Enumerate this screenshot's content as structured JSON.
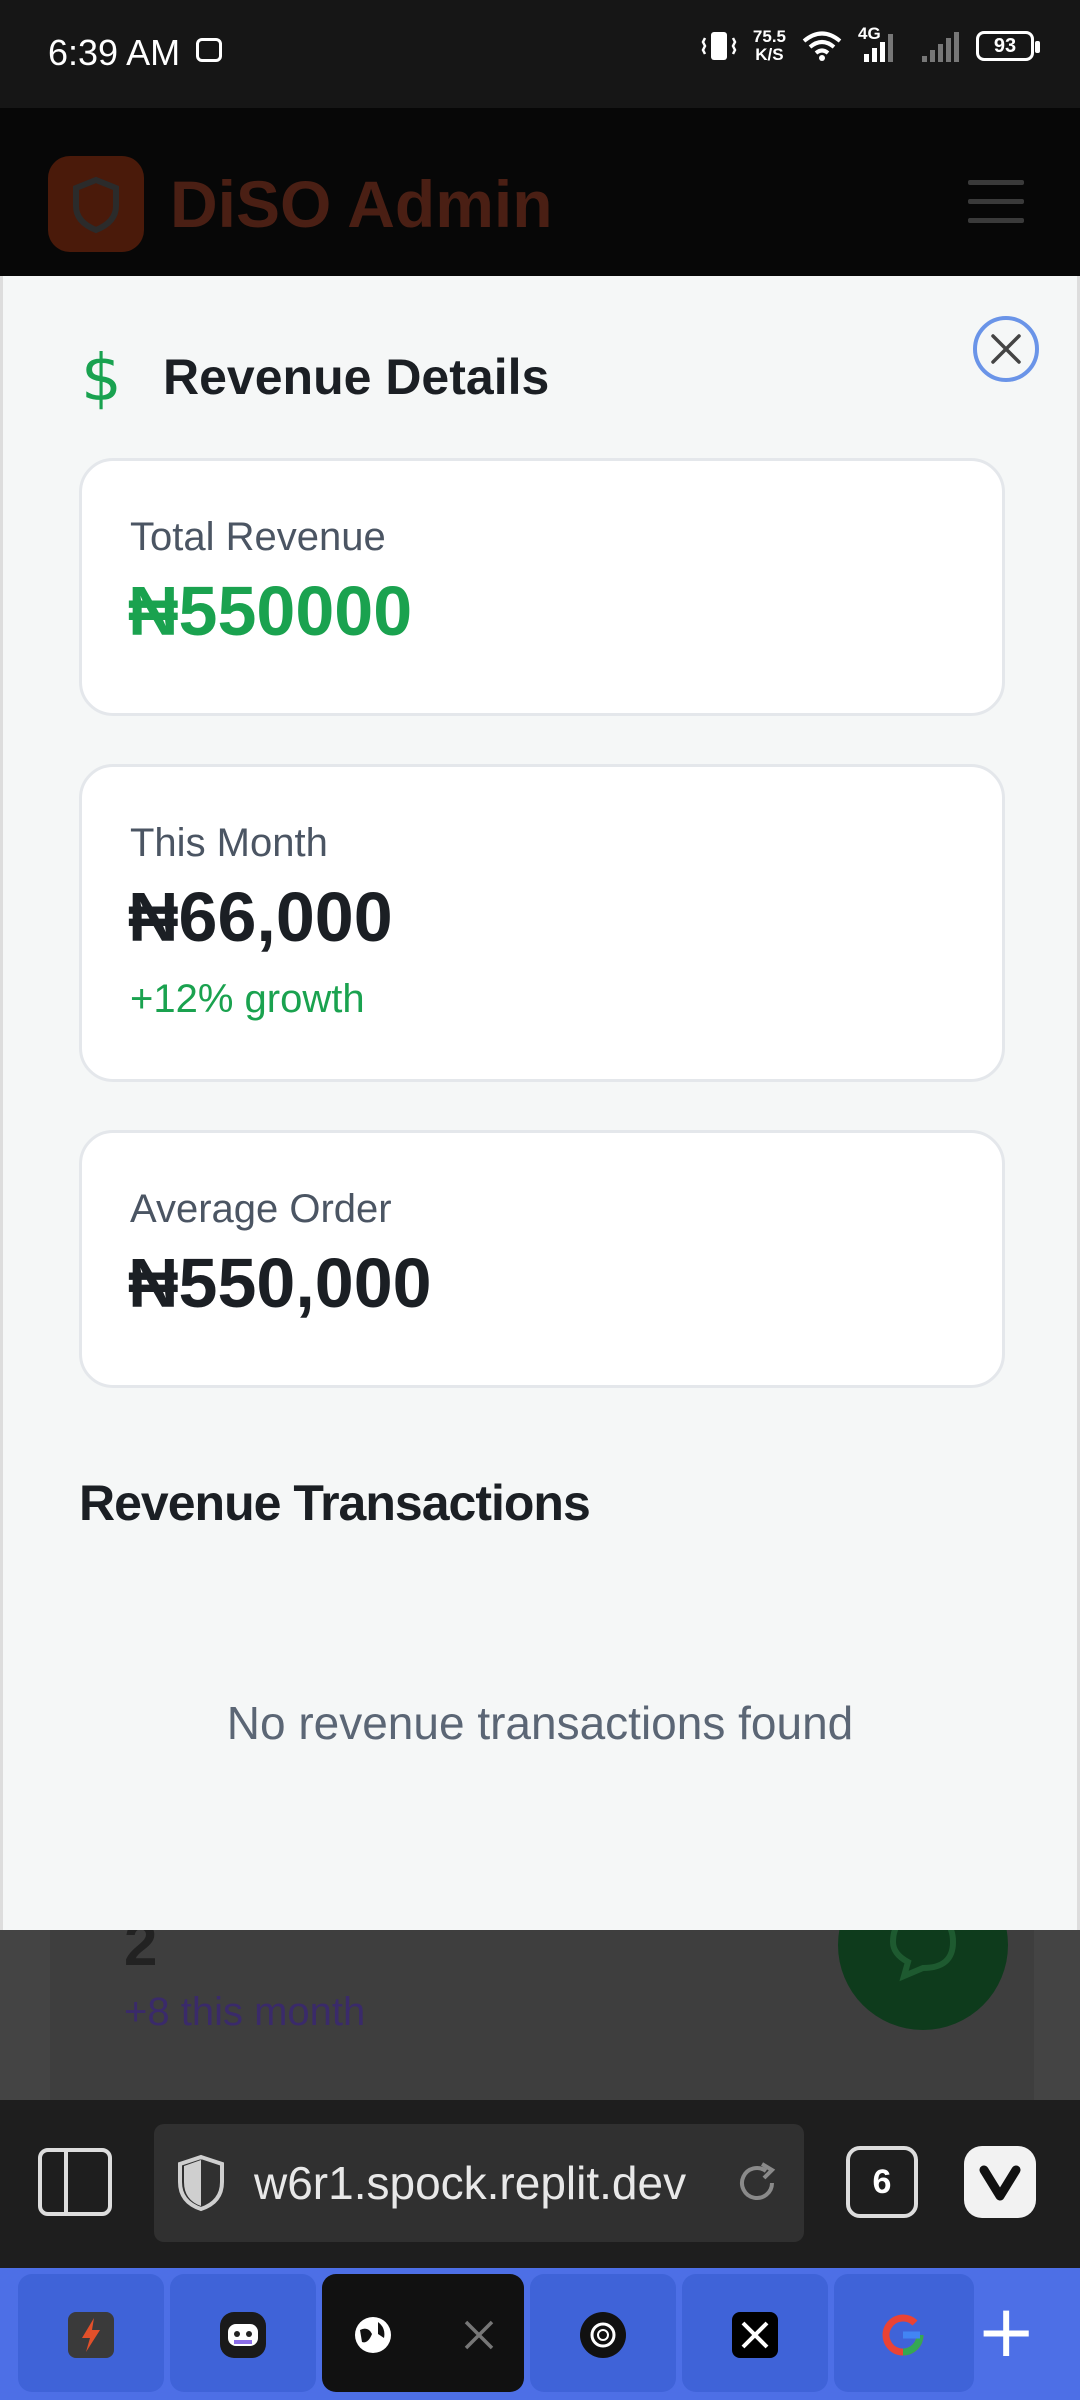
{
  "status_bar": {
    "time": "6:39 AM",
    "net_speed_value": "75.5",
    "net_speed_unit": "K/S",
    "network": "4G",
    "battery": "93"
  },
  "app_bar": {
    "title": "DiSO Admin"
  },
  "background": {
    "stat_value": "2",
    "stat_growth": "+8 this month"
  },
  "modal": {
    "title": "Revenue Details",
    "cards": [
      {
        "label": "Total Revenue",
        "value": "₦550000"
      },
      {
        "label": "This Month",
        "value": "₦66,000",
        "growth": "+12% growth"
      },
      {
        "label": "Average Order",
        "value": "₦550,000"
      }
    ],
    "section_title": "Revenue Transactions",
    "empty_text": "No revenue transactions found"
  },
  "browser": {
    "url": "w6r1.spock.replit.dev",
    "tab_count": "6"
  },
  "colors": {
    "accent_green": "#1aa24f",
    "close_ring": "#6a94e8",
    "tab_bar": "#4d6fe6"
  }
}
